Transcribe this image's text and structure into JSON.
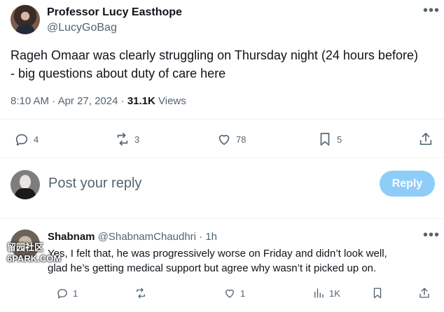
{
  "tweet": {
    "author_name": "Professor Lucy Easthope",
    "author_handle": "@LucyGoBag",
    "text_line1": "Rageh Omaar was clearly struggling on Thursday night (24 hours before)",
    "text_line2": "- big questions about duty of care here",
    "time": "8:10 AM",
    "date": "Apr 27, 2024",
    "separator": "·",
    "views_count": "31.1K",
    "views_label": "Views",
    "actions": {
      "replies": "4",
      "reposts": "3",
      "likes": "78",
      "bookmarks": "5"
    }
  },
  "composer": {
    "placeholder": "Post your reply",
    "reply_label": "Reply"
  },
  "reply": {
    "author_name": "Shabnam",
    "author_handle": "@ShabnamChaudhri",
    "time_ago": "· 1h",
    "text_line1": "Yes, I felt that, he was progressively worse on Friday and didn’t look well,",
    "text_line2": "glad he’s getting medical support but agree why wasn’t it picked up on.",
    "actions": {
      "replies": "1",
      "reposts": "",
      "likes": "1",
      "views": "1K"
    }
  },
  "watermark": {
    "line1": "留园社区",
    "line2": "6PARK.COM"
  },
  "colors": {
    "accent_disabled": "#8ecdf8",
    "secondary_text": "#536471",
    "primary_text": "#0f1419"
  },
  "icons": [
    "more-icon",
    "reply-icon",
    "repost-icon",
    "like-icon",
    "bookmark-icon",
    "share-icon",
    "views-icon"
  ]
}
